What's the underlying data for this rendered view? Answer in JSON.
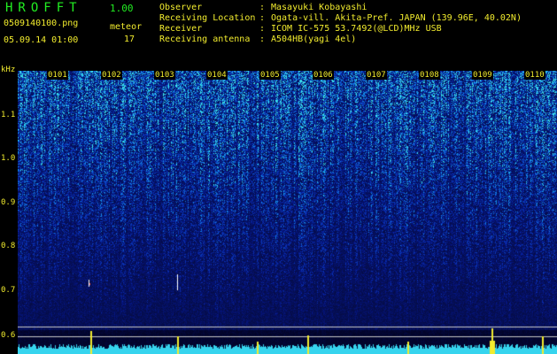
{
  "header": {
    "logo": "HROFFT",
    "version": "1.00",
    "filename": "0509140100.png",
    "datetime": "05.09.14 01:00",
    "meteor_label": "meteor",
    "meteor_count": "17",
    "info": [
      {
        "label": "Observer",
        "value": "Masayuki Kobayashi"
      },
      {
        "label": "Receiving Location",
        "value": "Ogata-vill. Akita-Pref. JAPAN (139.96E, 40.02N)"
      },
      {
        "label": "Receiver",
        "value": "ICOM IC-575 53.7492(@LCD)MHz USB"
      },
      {
        "label": "Receiving antenna",
        "value": "A504HB(yagi 4el)"
      }
    ],
    "separator": ":"
  },
  "plot": {
    "y_unit": "kHz",
    "y_ticks": [
      "1.1",
      "1.0",
      "0.9",
      "0.8",
      "0.7",
      "0.6"
    ],
    "x_ticks": [
      "0101",
      "0102",
      "0103",
      "0104",
      "0105",
      "0106",
      "0107",
      "0108",
      "0109",
      "0110"
    ],
    "colors": {
      "background": "#000000",
      "label": "#f2ec2e",
      "accent": "#22ee22",
      "noise_low": "#0a1a6a",
      "noise_high": "#3cc8e8"
    }
  }
}
